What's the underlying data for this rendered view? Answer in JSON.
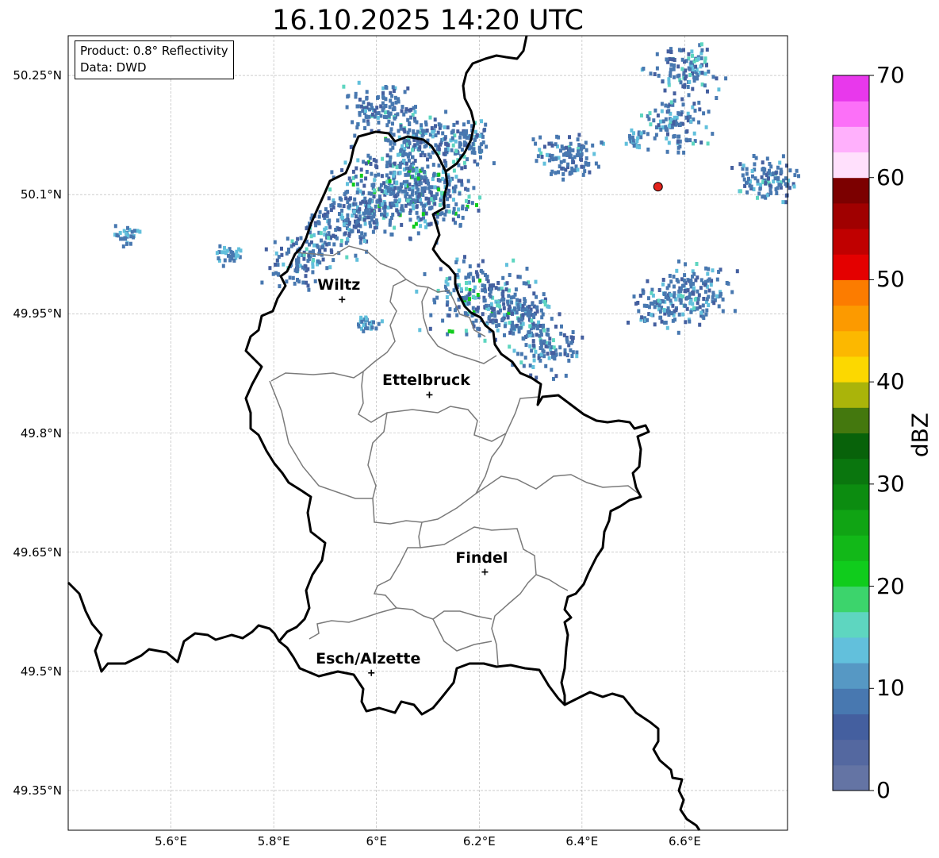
{
  "title": "16.10.2025 14:20 UTC",
  "info": {
    "line1": "Product: 0.8° Reflectivity",
    "line2": "Data: DWD"
  },
  "axes": {
    "lat_ticks": [
      {
        "value": 50.25,
        "label": "50.25°N"
      },
      {
        "value": 50.1,
        "label": "50.1°N"
      },
      {
        "value": 49.95,
        "label": "49.95°N"
      },
      {
        "value": 49.8,
        "label": "49.8°N"
      },
      {
        "value": 49.65,
        "label": "49.65°N"
      },
      {
        "value": 49.5,
        "label": "49.5°N"
      },
      {
        "value": 49.35,
        "label": "49.35°N"
      }
    ],
    "lon_ticks": [
      {
        "value": 5.6,
        "label": "5.6°E"
      },
      {
        "value": 5.8,
        "label": "5.8°E"
      },
      {
        "value": 6.0,
        "label": "6°E"
      },
      {
        "value": 6.2,
        "label": "6.2°E"
      },
      {
        "value": 6.4,
        "label": "6.4°E"
      },
      {
        "value": 6.6,
        "label": "6.6°E"
      }
    ],
    "lon_range": [
      5.4,
      6.8
    ],
    "lat_range": [
      49.3,
      50.3
    ],
    "grid": true
  },
  "cities": [
    {
      "name": "Wiltz",
      "lon": 5.933,
      "lat": 49.968
    },
    {
      "name": "Ettelbruck",
      "lon": 6.103,
      "lat": 49.848
    },
    {
      "name": "Findel",
      "lon": 6.211,
      "lat": 49.625
    },
    {
      "name": "Esch/Alzette",
      "lon": 5.99,
      "lat": 49.498
    }
  ],
  "radar_site": {
    "lon": 6.548,
    "lat": 50.11,
    "color": "#e3231c"
  },
  "colorbar": {
    "label": "dBZ",
    "min": 0,
    "max": 70,
    "step": 2.5,
    "ticks": [
      "0",
      "10",
      "20",
      "30",
      "40",
      "50",
      "60",
      "70"
    ],
    "colors": [
      "#6474a4",
      "#5468a0",
      "#445f9f",
      "#4878b0",
      "#5698c4",
      "#62c0dc",
      "#5ed6c0",
      "#3cd46c",
      "#10cc1c",
      "#12b818",
      "#10a414",
      "#0c8c10",
      "#0a760e",
      "#08620a",
      "#44780e",
      "#aab40a",
      "#fcd800",
      "#fcb800",
      "#fc9a00",
      "#fc7c00",
      "#e40000",
      "#c00000",
      "#a00000",
      "#7c0000",
      "#ffe0fc",
      "#ffb0fc",
      "#fc70f8",
      "#e838ec"
    ]
  },
  "echo_clusters": [
    {
      "lon": 6.03,
      "lat": 50.12,
      "intensity": 2
    },
    {
      "lon": 6.09,
      "lat": 50.1,
      "intensity": 2
    },
    {
      "lon": 5.98,
      "lat": 50.08,
      "intensity": 1
    },
    {
      "lon": 5.92,
      "lat": 50.06,
      "intensity": 1
    },
    {
      "lon": 5.85,
      "lat": 50.02,
      "intensity": 1
    },
    {
      "lon": 6.0,
      "lat": 50.21,
      "intensity": 1
    },
    {
      "lon": 6.08,
      "lat": 50.17,
      "intensity": 1
    },
    {
      "lon": 6.16,
      "lat": 50.17,
      "intensity": 1
    },
    {
      "lon": 6.2,
      "lat": 49.97,
      "intensity": 2
    },
    {
      "lon": 6.28,
      "lat": 49.95,
      "intensity": 1
    },
    {
      "lon": 6.33,
      "lat": 49.91,
      "intensity": 1
    },
    {
      "lon": 6.37,
      "lat": 50.15,
      "intensity": 1
    },
    {
      "lon": 6.58,
      "lat": 50.19,
      "intensity": 1
    },
    {
      "lon": 6.6,
      "lat": 50.26,
      "intensity": 1
    },
    {
      "lon": 6.62,
      "lat": 49.98,
      "intensity": 1
    },
    {
      "lon": 6.56,
      "lat": 49.96,
      "intensity": 1
    },
    {
      "lon": 6.76,
      "lat": 50.12,
      "intensity": 1
    },
    {
      "lon": 5.71,
      "lat": 50.03,
      "intensity": 0
    },
    {
      "lon": 5.51,
      "lat": 50.05,
      "intensity": 0
    },
    {
      "lon": 5.98,
      "lat": 49.94,
      "intensity": 0
    },
    {
      "lon": 6.5,
      "lat": 50.17,
      "intensity": 0
    }
  ]
}
